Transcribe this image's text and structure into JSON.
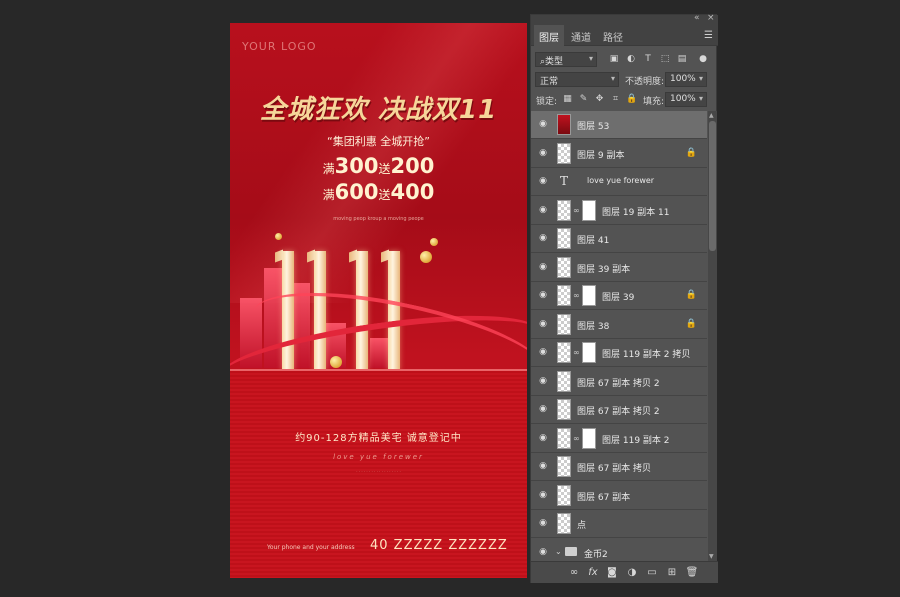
{
  "poster": {
    "logo": "YOUR LOGO",
    "headline": "全城狂欢 决战双11",
    "tagline": "“集团利惠 全城开抢”",
    "offer1": {
      "a": "满",
      "b": "300",
      "c": "送",
      "d": "200"
    },
    "offer2": {
      "a": "满",
      "b": "600",
      "c": "送",
      "d": "400"
    },
    "sub": "moving peop kroup a moving peope",
    "info": "约90-128方精品美宅  诚意登记中",
    "script": "love yue forewer",
    "phone": "Your phone and your address",
    "number": "40 ZZZZZ ZZZZZZ"
  },
  "panel": {
    "collapse": "«",
    "close": "×",
    "tabs": [
      "图层",
      "通道",
      "路径"
    ],
    "menu_icon": "hamburger-icon",
    "filter_type": "类型",
    "blend_mode": "正常",
    "opacity_label": "不透明度:",
    "opacity_value": "100%",
    "lock_label": "锁定:",
    "fill_label": "填充:",
    "fill_value": "100%",
    "layers": [
      {
        "name": "图层 53",
        "thumb": "red",
        "selected": true
      },
      {
        "name": "图层 9 副本",
        "lock": true
      },
      {
        "name": "love yue forewer",
        "thumb": "text"
      },
      {
        "name": "图层 19 副本 11",
        "mask": true
      },
      {
        "name": "图层 41"
      },
      {
        "name": "图层 39 副本"
      },
      {
        "name": "图层 39",
        "mask": true,
        "lock": true
      },
      {
        "name": "图层 38",
        "lock": true
      },
      {
        "name": "图层 119 副本 2 拷贝",
        "mask": true
      },
      {
        "name": "图层 67 副本 拷贝 2"
      },
      {
        "name": "图层 67 副本 拷贝 2"
      },
      {
        "name": "图层 119 副本 2",
        "mask": true
      },
      {
        "name": "图层 67 副本 拷贝"
      },
      {
        "name": "图层 67 副本"
      },
      {
        "name": "点"
      },
      {
        "name": "金币2",
        "group": true
      }
    ],
    "bottom_icons": [
      "link-icon",
      "fx-icon",
      "mask-icon",
      "adjustment-icon",
      "folder-icon",
      "new-layer-icon",
      "trash-icon"
    ]
  }
}
